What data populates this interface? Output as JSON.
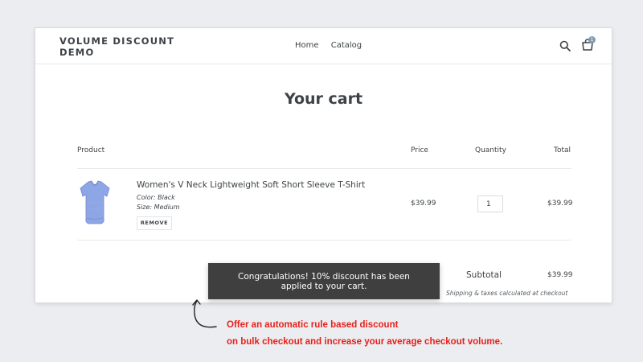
{
  "header": {
    "logo": "VOLUME DISCOUNT DEMO",
    "nav": [
      "Home",
      "Catalog"
    ],
    "cart_count": "1",
    "icons": [
      "search-icon",
      "cart-icon"
    ]
  },
  "cart": {
    "title": "Your cart",
    "columns": {
      "product": "Product",
      "price": "Price",
      "quantity": "Quantity",
      "total": "Total"
    },
    "items": [
      {
        "name": "Women's V Neck Lightweight Soft Short Sleeve T-Shirt",
        "color": "Color: Black",
        "size": "Size: Medium",
        "remove_label": "REMOVE",
        "price": "$39.99",
        "quantity": "1",
        "total": "$39.99"
      }
    ],
    "subtotal_label": "Subtotal",
    "subtotal_value": "$39.99",
    "shipping_note": "Shipping & taxes calculated at checkout"
  },
  "toast": {
    "line1": "Congratulations! 10% discount has been",
    "line2": "applied to your cart."
  },
  "promo": {
    "line1": "Offer an automatic rule based discount",
    "line2": "on bulk checkout and increase your average checkout volume."
  },
  "colors": {
    "background": "#ebedf0",
    "text": "#3d4246",
    "toast_bg": "#3f3f3f",
    "promo_red": "#e8201a",
    "product_blue": "#8fa6e6"
  }
}
